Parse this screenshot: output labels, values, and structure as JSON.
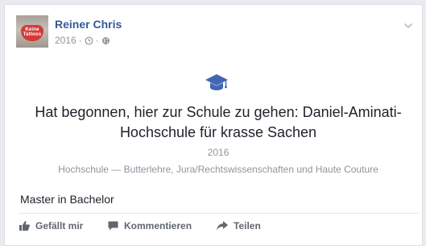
{
  "post": {
    "author": "Reiner Chris",
    "avatar_text_line1": "Keine",
    "avatar_text_line2": "Tattoos",
    "date": "2016",
    "meta_separator": "·",
    "life_event": {
      "icon": "graduation-cap-icon",
      "title": "Hat begonnen, hier zur Schule zu gehen: Daniel-Aminati-Hochschule für krasse Sachen",
      "year": "2016",
      "details": "Hochschule — Butterlehre, Jura/Rechtswissenschaften und Haute Couture"
    },
    "text": "Master in Bachelor"
  },
  "actions": {
    "like": "Gefällt mir",
    "comment": "Kommentieren",
    "share": "Teilen"
  },
  "colors": {
    "link": "#365899",
    "muted": "#90949c",
    "accent": "#4267b2",
    "action_text": "#616770"
  }
}
